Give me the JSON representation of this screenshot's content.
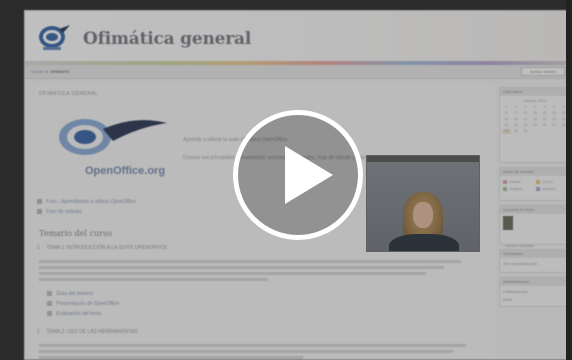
{
  "video": {
    "play_button_label": "Play"
  },
  "header": {
    "site_title": "Ofimática general",
    "logo_name": "course-logo"
  },
  "nav": {
    "breadcrumb_home": "Moodle",
    "breadcrumb_current": "OFIMATIC",
    "edit_button": "Activar edición"
  },
  "main": {
    "section_heading": "OFIMÁTICA GENERAL",
    "logo_text": "OpenOffice.org",
    "intro_line_1": "Aprende a utilizar la suite ofimática OpenOffice.",
    "intro_line_2": "Conoce sus principales herramientas: procesador de textos, hoja de cálculo y más.",
    "resources": [
      {
        "label": "Foro - Aprendiendo a utilizar OpenOffice"
      },
      {
        "label": "Foro de noticias"
      }
    ],
    "temario_title": "Temario del curso",
    "topics": [
      {
        "number": "1",
        "label": "TEMA 1: INTRODUCCIÓN A LA SUITE OPENOFFICE"
      },
      {
        "number": "2",
        "label": "TEMA 2: USO DE LAS HERRAMIENTAS"
      }
    ],
    "topic1_links": [
      {
        "label": "Guía del alumno"
      },
      {
        "label": "Presentación de OpenOffice"
      },
      {
        "label": "Evaluación del tema"
      }
    ]
  },
  "sidebar": {
    "calendar": {
      "title": "Calendario",
      "month": "octubre 2012",
      "days": [
        "1",
        "2",
        "3",
        "4",
        "5",
        "6",
        "7",
        "8",
        "9",
        "10",
        "11",
        "12",
        "13",
        "14",
        "15",
        "16",
        "17",
        "18",
        "19",
        "20",
        "21",
        "22",
        "23",
        "24",
        "25",
        "26",
        "27",
        "28",
        "29",
        "30",
        "31"
      ],
      "today": "29"
    },
    "legend": {
      "title": "Clave de eventos",
      "items": [
        {
          "label": "Global",
          "color": "#d9a0a0"
        },
        {
          "label": "Curso",
          "color": "#e6c37f"
        },
        {
          "label": "Grupos",
          "color": "#9fc08a"
        },
        {
          "label": "Usuario",
          "color": "#a7a7d3"
        }
      ]
    },
    "participants": {
      "title": "Usuarios en línea",
      "entry": "Usuario conectado"
    },
    "news": {
      "title": "Novedades",
      "text": "Sin novedades aún"
    },
    "admin": {
      "title": "Administración",
      "items": [
        "Calificaciones",
        "Perfil"
      ]
    }
  },
  "colors": {
    "accent": "#8d9ab5",
    "play": "#ffffff"
  }
}
